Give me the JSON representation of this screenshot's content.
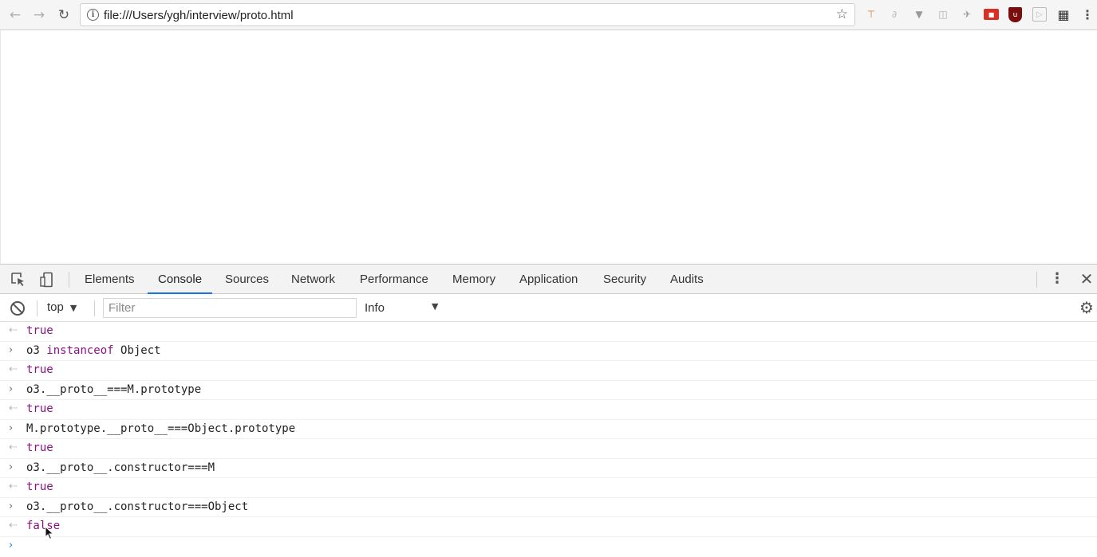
{
  "browser": {
    "url": "file:///Users/ygh/interview/proto.html",
    "nav": {
      "back": "←",
      "forward": "→",
      "reload": "↻"
    },
    "icons": [
      "star-icon",
      "info-icon",
      "extension-icons"
    ]
  },
  "devtools": {
    "tabs": [
      {
        "label": "Elements"
      },
      {
        "label": "Console"
      },
      {
        "label": "Sources"
      },
      {
        "label": "Network"
      },
      {
        "label": "Performance"
      },
      {
        "label": "Memory"
      },
      {
        "label": "Application"
      },
      {
        "label": "Security"
      },
      {
        "label": "Audits"
      }
    ],
    "selected_tab": "Console",
    "accent": "#1a73e8"
  },
  "filterbar": {
    "context": "top",
    "filter_placeholder": "Filter",
    "level": "Info"
  },
  "console": {
    "rows": [
      {
        "kind": "result",
        "text": "true"
      },
      {
        "kind": "input",
        "pre": "o3 ",
        "kw": "instanceof",
        "post": " Object"
      },
      {
        "kind": "result",
        "text": "true"
      },
      {
        "kind": "input",
        "text": "o3.__proto__===M.prototype"
      },
      {
        "kind": "result",
        "text": "true"
      },
      {
        "kind": "input",
        "text": "M.prototype.__proto__===Object.prototype"
      },
      {
        "kind": "result",
        "text": "true"
      },
      {
        "kind": "input",
        "text": "o3.__proto__.constructor===M"
      },
      {
        "kind": "result",
        "text": "true"
      },
      {
        "kind": "input",
        "text": "o3.__proto__.constructor===Object"
      },
      {
        "kind": "result",
        "text": "false"
      }
    ],
    "value_color": "#881280"
  }
}
